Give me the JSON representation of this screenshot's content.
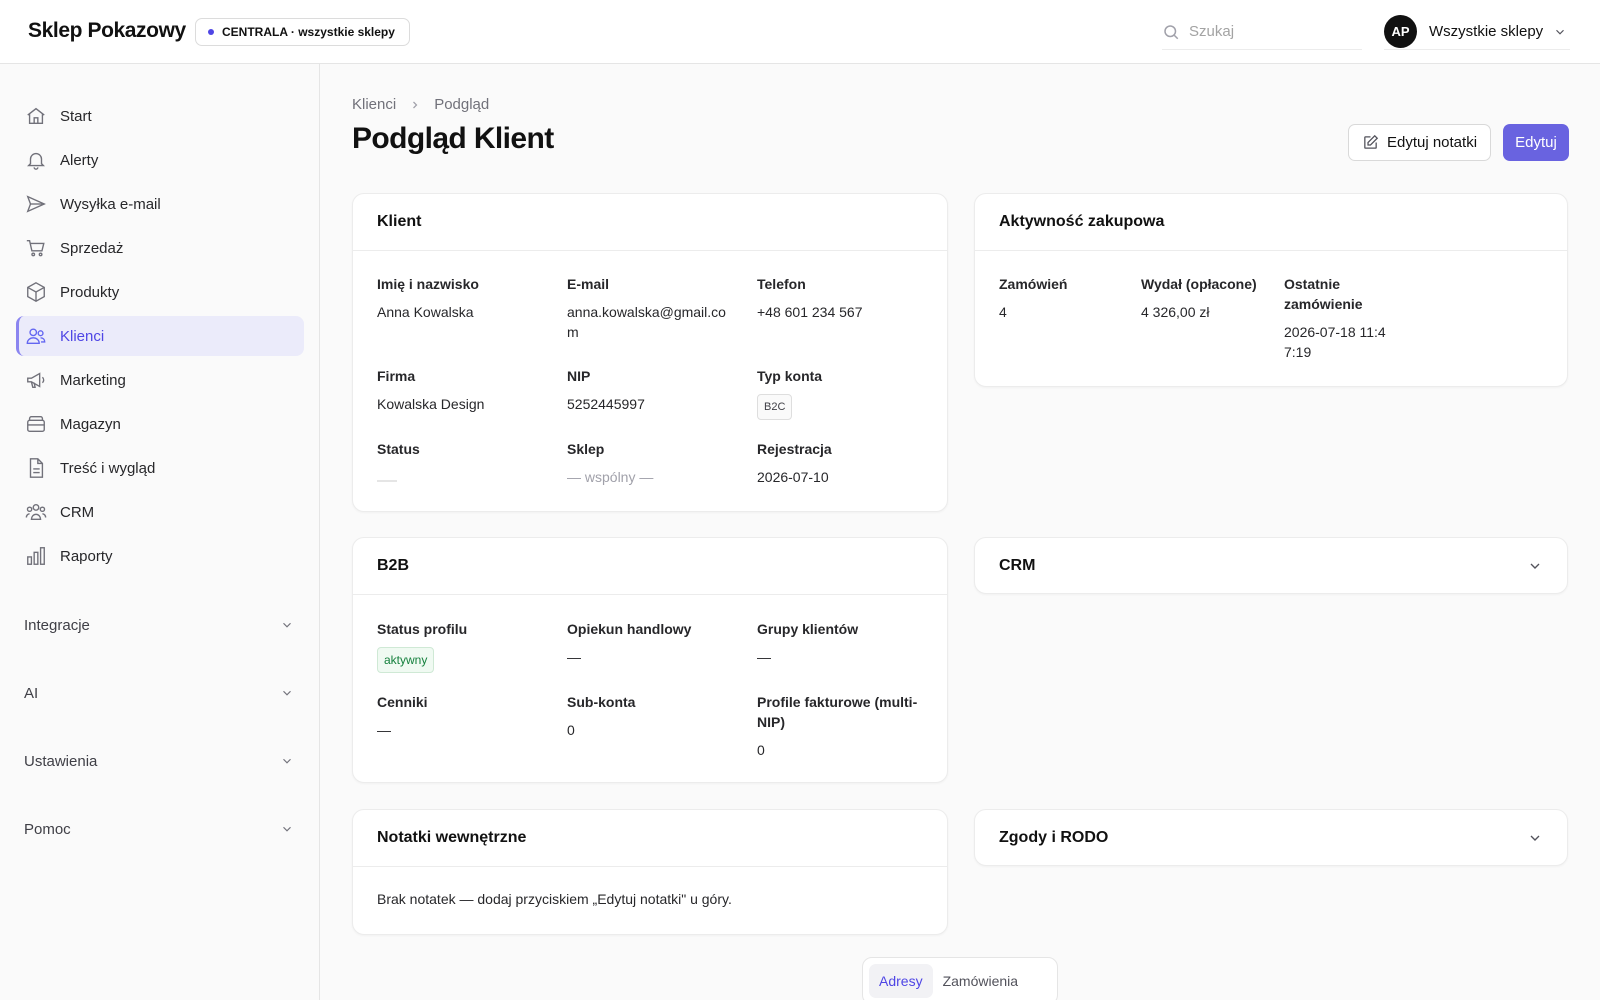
{
  "app": {
    "brand": "Sklep Pokazowy",
    "store_badge": "CENTRALA · wszystkie sklepy",
    "search_placeholder": "Szukaj",
    "user_initials": "AP",
    "store_selector": "Wszystkie sklepy"
  },
  "sidebar": {
    "items": [
      {
        "label": "Start",
        "icon": "home-icon"
      },
      {
        "label": "Alerty",
        "icon": "bell-icon"
      },
      {
        "label": "Wysyłka e-mail",
        "icon": "send-icon"
      },
      {
        "label": "Sprzedaż",
        "icon": "cart-icon"
      },
      {
        "label": "Produkty",
        "icon": "box-icon"
      },
      {
        "label": "Klienci",
        "icon": "users-icon",
        "active": true
      },
      {
        "label": "Marketing",
        "icon": "megaphone-icon"
      },
      {
        "label": "Magazyn",
        "icon": "warehouse-icon"
      },
      {
        "label": "Treść i wygląd",
        "icon": "document-icon"
      },
      {
        "label": "CRM",
        "icon": "crm-icon"
      },
      {
        "label": "Raporty",
        "icon": "bar-chart-icon"
      }
    ],
    "groups": [
      {
        "label": "Integracje"
      },
      {
        "label": "AI"
      },
      {
        "label": "Ustawienia"
      },
      {
        "label": "Pomoc"
      }
    ]
  },
  "breadcrumb": {
    "parent": "Klienci",
    "current": "Podgląd"
  },
  "page": {
    "title": "Podgląd Klient",
    "edit_notes_label": "Edytuj notatki",
    "edit_label": "Edytuj"
  },
  "client_card": {
    "title": "Klient",
    "fields": {
      "name": {
        "label": "Imię i nazwisko",
        "value": "Anna Kowalska"
      },
      "email": {
        "label": "E-mail",
        "value": "anna.kowalska@gmail.com"
      },
      "phone": {
        "label": "Telefon",
        "value": "+48 601 234 567"
      },
      "company": {
        "label": "Firma",
        "value": "Kowalska Design"
      },
      "nip": {
        "label": "NIP",
        "value": "5252445997"
      },
      "account_type": {
        "label": "Typ konta",
        "value": "B2C"
      },
      "status": {
        "label": "Status"
      },
      "shop": {
        "label": "Sklep",
        "value": "— wspólny —"
      },
      "registration": {
        "label": "Rejestracja",
        "value": "2026-07-10"
      }
    }
  },
  "activity_card": {
    "title": "Aktywność zakupowa",
    "orders": {
      "label": "Zamówień",
      "value": "4"
    },
    "spent": {
      "label": "Wydał (opłacone)",
      "value": "4 326,00 zł"
    },
    "last_order": {
      "label": "Ostatnie zamówienie",
      "value": "2026-07-18 11:47:19"
    }
  },
  "b2b_card": {
    "title": "B2B",
    "profile_status": {
      "label": "Status profilu",
      "value": "aktywny"
    },
    "account_manager": {
      "label": "Opiekun handlowy",
      "value": "—"
    },
    "customer_groups": {
      "label": "Grupy klientów",
      "value": "—"
    },
    "price_lists": {
      "label": "Cenniki",
      "value": "—"
    },
    "sub_accounts": {
      "label": "Sub-konta",
      "value": "0"
    },
    "billing_profiles": {
      "label": "Profile fakturowe (multi-NIP)",
      "value": "0"
    }
  },
  "crm_card": {
    "title": "CRM"
  },
  "notes_card": {
    "title": "Notatki wewnętrzne",
    "text": "Brak notatek — dodaj przyciskiem „Edytuj notatki\" u góry."
  },
  "consents_card": {
    "title": "Zgody i RODO"
  },
  "tabs": [
    {
      "label": "Adresy",
      "active": true
    },
    {
      "label": "Zamówienia"
    }
  ],
  "colors": {
    "accent": "#6963e0",
    "active_nav_bg": "#ebebfa",
    "green": "#15803d"
  }
}
